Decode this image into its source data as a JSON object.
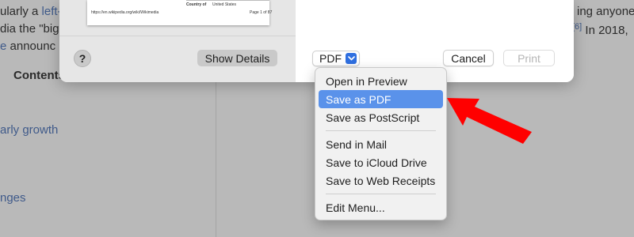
{
  "background_page": {
    "line1_prefix": "ularly a ",
    "line1_link": "left-",
    "line1_suffix": "ing anyone t",
    "line2_prefix": "dia the \"bigg",
    "line2_ref": "[6]",
    "line2_suffix": " In 2018,",
    "line3_link": "e",
    "line3_suffix": " announc",
    "contents_title": "Contents",
    "link_growth": "arly growth",
    "link_changes": "nges"
  },
  "preview": {
    "thumb_label": "Country of",
    "thumb_value": "United States",
    "thumb_url": "https://en.wikipedia.org/wiki/Wikimedia",
    "thumb_page": "Page 1 of 87"
  },
  "dialog": {
    "help_label": "?",
    "show_details_label": "Show Details",
    "pdf_label": "PDF",
    "cancel_label": "Cancel",
    "print_label": "Print"
  },
  "pdf_menu": {
    "items": [
      {
        "label": "Open in Preview",
        "selected": false
      },
      {
        "label": "Save as PDF",
        "selected": true
      },
      {
        "label": "Save as PostScript",
        "selected": false
      },
      {
        "label": "Send in Mail",
        "selected": false
      },
      {
        "label": "Save to iCloud Drive",
        "selected": false
      },
      {
        "label": "Save to Web Receipts",
        "selected": false
      },
      {
        "label": "Edit Menu...",
        "selected": false
      }
    ]
  },
  "colors": {
    "selection": "#5a92ea",
    "annotation_arrow": "#ff0000",
    "accent": "#2f6fe0"
  },
  "icons": [
    "chevron-down-icon",
    "help-icon",
    "annotation-arrow"
  ]
}
